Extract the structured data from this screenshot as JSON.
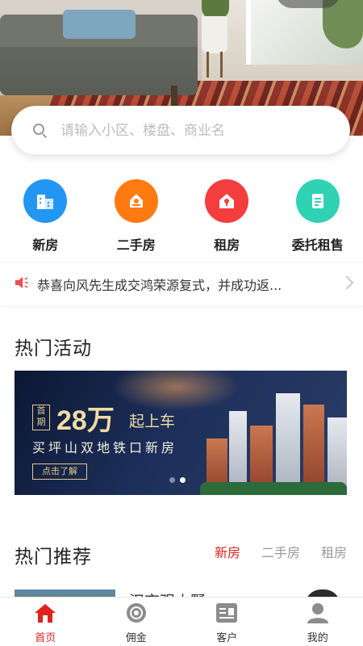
{
  "search": {
    "placeholder": "请输入小区、楼盘、商业名"
  },
  "categories": [
    {
      "label": "新房",
      "icon": "building-icon",
      "color": "#2196f3"
    },
    {
      "label": "二手房",
      "icon": "house-key-icon",
      "color": "#ff7b12"
    },
    {
      "label": "租房",
      "icon": "house-lock-icon",
      "color": "#f53d3d"
    },
    {
      "label": "委托租售",
      "icon": "document-icon",
      "color": "#2fd2b4"
    }
  ],
  "notice": {
    "text": "恭喜向风先生成交鸿荣源复式，并成功返..."
  },
  "sections": {
    "activities_title": "热门活动",
    "recommend_title": "热门推荐"
  },
  "banner": {
    "tag": "首期",
    "amount": "28万",
    "suffix": "起上车",
    "subtitle": "买坪山双地铁口新房",
    "cta": "点击了解"
  },
  "recommend_tabs": [
    {
      "label": "新房",
      "active": true
    },
    {
      "label": "二手房",
      "active": false
    },
    {
      "label": "租房",
      "active": false
    }
  ],
  "recommend_item": {
    "title": "汉京观山墅"
  },
  "tabbar": [
    {
      "label": "首页",
      "icon": "home-icon",
      "active": true
    },
    {
      "label": "佣金",
      "icon": "coin-icon",
      "active": false
    },
    {
      "label": "客户",
      "icon": "customer-card-icon",
      "active": false
    },
    {
      "label": "我的",
      "icon": "user-icon",
      "active": false
    }
  ],
  "colors": {
    "accent": "#e0231c"
  }
}
